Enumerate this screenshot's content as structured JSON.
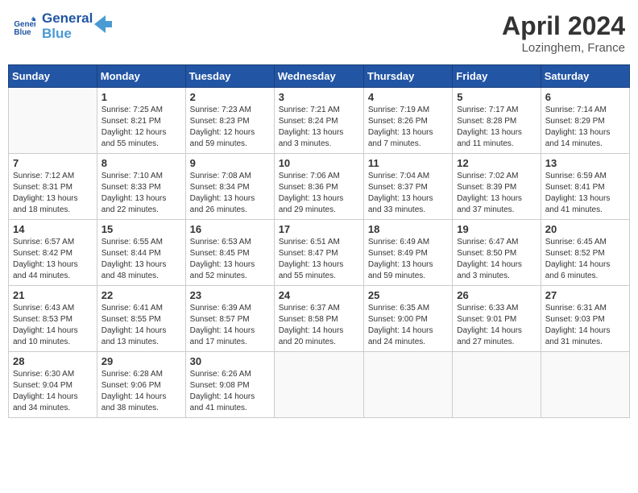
{
  "header": {
    "logo_line1": "General",
    "logo_line2": "Blue",
    "month_title": "April 2024",
    "location": "Lozinghem, France"
  },
  "calendar": {
    "days_of_week": [
      "Sunday",
      "Monday",
      "Tuesday",
      "Wednesday",
      "Thursday",
      "Friday",
      "Saturday"
    ],
    "weeks": [
      [
        {
          "day": "",
          "info": ""
        },
        {
          "day": "1",
          "info": "Sunrise: 7:25 AM\nSunset: 8:21 PM\nDaylight: 12 hours\nand 55 minutes."
        },
        {
          "day": "2",
          "info": "Sunrise: 7:23 AM\nSunset: 8:23 PM\nDaylight: 12 hours\nand 59 minutes."
        },
        {
          "day": "3",
          "info": "Sunrise: 7:21 AM\nSunset: 8:24 PM\nDaylight: 13 hours\nand 3 minutes."
        },
        {
          "day": "4",
          "info": "Sunrise: 7:19 AM\nSunset: 8:26 PM\nDaylight: 13 hours\nand 7 minutes."
        },
        {
          "day": "5",
          "info": "Sunrise: 7:17 AM\nSunset: 8:28 PM\nDaylight: 13 hours\nand 11 minutes."
        },
        {
          "day": "6",
          "info": "Sunrise: 7:14 AM\nSunset: 8:29 PM\nDaylight: 13 hours\nand 14 minutes."
        }
      ],
      [
        {
          "day": "7",
          "info": "Sunrise: 7:12 AM\nSunset: 8:31 PM\nDaylight: 13 hours\nand 18 minutes."
        },
        {
          "day": "8",
          "info": "Sunrise: 7:10 AM\nSunset: 8:33 PM\nDaylight: 13 hours\nand 22 minutes."
        },
        {
          "day": "9",
          "info": "Sunrise: 7:08 AM\nSunset: 8:34 PM\nDaylight: 13 hours\nand 26 minutes."
        },
        {
          "day": "10",
          "info": "Sunrise: 7:06 AM\nSunset: 8:36 PM\nDaylight: 13 hours\nand 29 minutes."
        },
        {
          "day": "11",
          "info": "Sunrise: 7:04 AM\nSunset: 8:37 PM\nDaylight: 13 hours\nand 33 minutes."
        },
        {
          "day": "12",
          "info": "Sunrise: 7:02 AM\nSunset: 8:39 PM\nDaylight: 13 hours\nand 37 minutes."
        },
        {
          "day": "13",
          "info": "Sunrise: 6:59 AM\nSunset: 8:41 PM\nDaylight: 13 hours\nand 41 minutes."
        }
      ],
      [
        {
          "day": "14",
          "info": "Sunrise: 6:57 AM\nSunset: 8:42 PM\nDaylight: 13 hours\nand 44 minutes."
        },
        {
          "day": "15",
          "info": "Sunrise: 6:55 AM\nSunset: 8:44 PM\nDaylight: 13 hours\nand 48 minutes."
        },
        {
          "day": "16",
          "info": "Sunrise: 6:53 AM\nSunset: 8:45 PM\nDaylight: 13 hours\nand 52 minutes."
        },
        {
          "day": "17",
          "info": "Sunrise: 6:51 AM\nSunset: 8:47 PM\nDaylight: 13 hours\nand 55 minutes."
        },
        {
          "day": "18",
          "info": "Sunrise: 6:49 AM\nSunset: 8:49 PM\nDaylight: 13 hours\nand 59 minutes."
        },
        {
          "day": "19",
          "info": "Sunrise: 6:47 AM\nSunset: 8:50 PM\nDaylight: 14 hours\nand 3 minutes."
        },
        {
          "day": "20",
          "info": "Sunrise: 6:45 AM\nSunset: 8:52 PM\nDaylight: 14 hours\nand 6 minutes."
        }
      ],
      [
        {
          "day": "21",
          "info": "Sunrise: 6:43 AM\nSunset: 8:53 PM\nDaylight: 14 hours\nand 10 minutes."
        },
        {
          "day": "22",
          "info": "Sunrise: 6:41 AM\nSunset: 8:55 PM\nDaylight: 14 hours\nand 13 minutes."
        },
        {
          "day": "23",
          "info": "Sunrise: 6:39 AM\nSunset: 8:57 PM\nDaylight: 14 hours\nand 17 minutes."
        },
        {
          "day": "24",
          "info": "Sunrise: 6:37 AM\nSunset: 8:58 PM\nDaylight: 14 hours\nand 20 minutes."
        },
        {
          "day": "25",
          "info": "Sunrise: 6:35 AM\nSunset: 9:00 PM\nDaylight: 14 hours\nand 24 minutes."
        },
        {
          "day": "26",
          "info": "Sunrise: 6:33 AM\nSunset: 9:01 PM\nDaylight: 14 hours\nand 27 minutes."
        },
        {
          "day": "27",
          "info": "Sunrise: 6:31 AM\nSunset: 9:03 PM\nDaylight: 14 hours\nand 31 minutes."
        }
      ],
      [
        {
          "day": "28",
          "info": "Sunrise: 6:30 AM\nSunset: 9:04 PM\nDaylight: 14 hours\nand 34 minutes."
        },
        {
          "day": "29",
          "info": "Sunrise: 6:28 AM\nSunset: 9:06 PM\nDaylight: 14 hours\nand 38 minutes."
        },
        {
          "day": "30",
          "info": "Sunrise: 6:26 AM\nSunset: 9:08 PM\nDaylight: 14 hours\nand 41 minutes."
        },
        {
          "day": "",
          "info": ""
        },
        {
          "day": "",
          "info": ""
        },
        {
          "day": "",
          "info": ""
        },
        {
          "day": "",
          "info": ""
        }
      ]
    ]
  }
}
